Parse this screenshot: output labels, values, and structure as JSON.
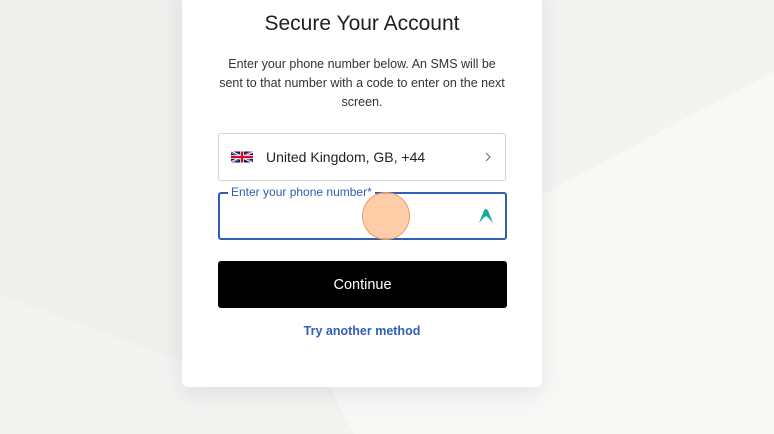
{
  "card": {
    "title": "Secure Your Account",
    "description": "Enter your phone number below. An SMS will be sent to that number with a code to enter on the next screen."
  },
  "country_select": {
    "value": "United Kingdom, GB, +44",
    "flag_icon": "uk-flag-icon",
    "chevron_icon": "chevron-right-icon"
  },
  "phone_field": {
    "label": "Enter your phone number*",
    "value": "",
    "extension_icon": "nordpass-icon"
  },
  "actions": {
    "continue_label": "Continue",
    "alt_method_label": "Try another method"
  },
  "colors": {
    "accent": "#2f5eb5",
    "button_bg": "#000000",
    "extension_icon": "#1aa89a"
  }
}
